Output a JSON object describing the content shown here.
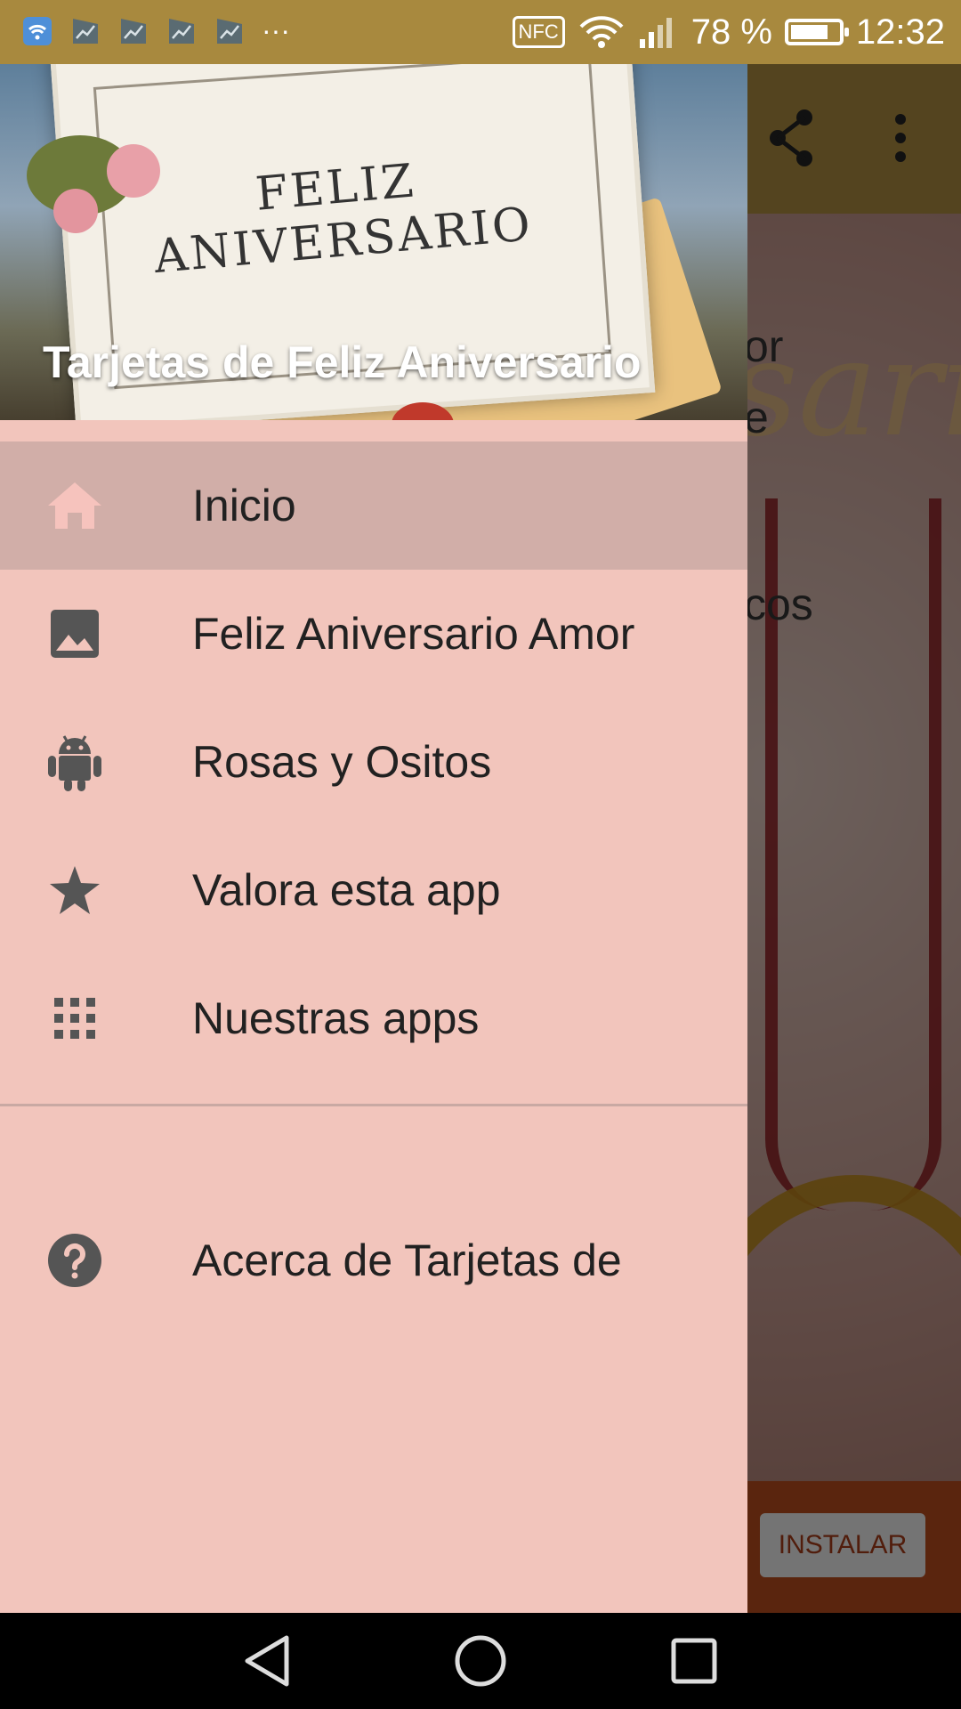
{
  "status_bar": {
    "battery": "78 %",
    "battery_level": 0.78,
    "time": "12:32",
    "nfc": "NFC",
    "more": "···"
  },
  "background_app": {
    "text_fragments": [
      "or",
      "e",
      "cos"
    ],
    "script_fragment": "sario",
    "ad_button": "INSTALAR"
  },
  "drawer": {
    "header_title": "Tarjetas de Feliz Aniversario",
    "card_text": "FELIZ ANIVERSARIO",
    "items": [
      {
        "label": "Inicio",
        "icon": "home-icon"
      },
      {
        "label": "Feliz Aniversario Amor",
        "icon": "image-icon"
      },
      {
        "label": "Rosas y Ositos",
        "icon": "android-icon"
      },
      {
        "label": "Valora esta app",
        "icon": "star-icon"
      },
      {
        "label": "Nuestras apps",
        "icon": "grid-icon"
      }
    ],
    "footer_item": {
      "label": "Acerca de Tarjetas de",
      "icon": "help-icon"
    }
  },
  "colors": {
    "status_bar": "#a8893e",
    "drawer_bg": "#f2c5bc",
    "active_item": "#d1aea8",
    "icon": "#555555"
  }
}
